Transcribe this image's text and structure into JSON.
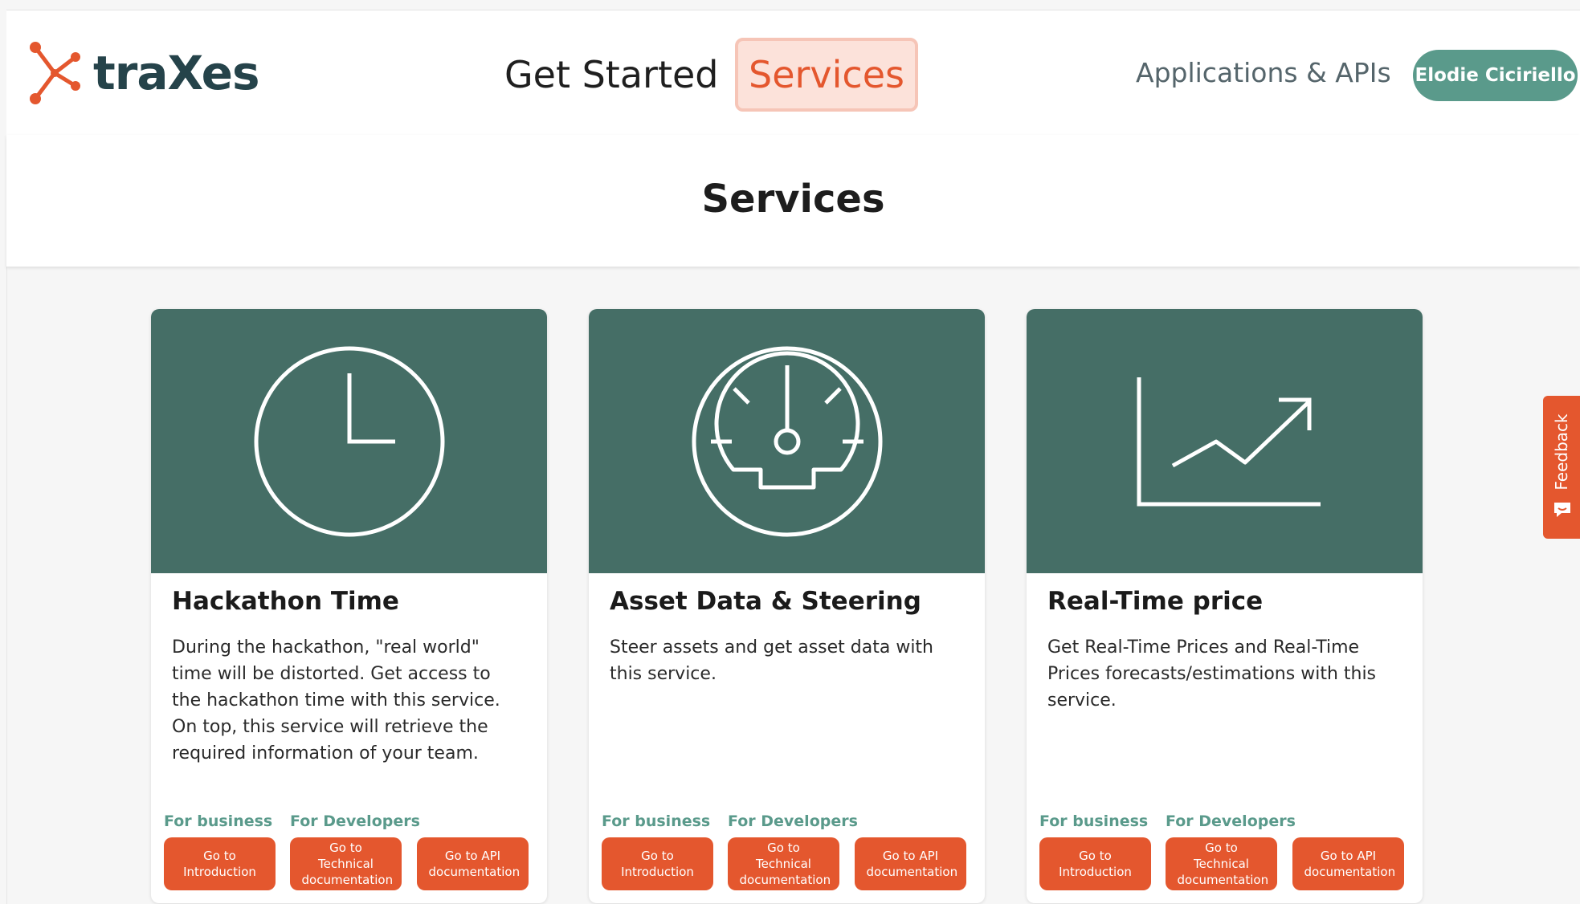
{
  "brand": {
    "name": "traXes",
    "accent": "#e4572e",
    "teal": "#456e66",
    "green": "#5a9a8b",
    "dark": "#25434a"
  },
  "nav": {
    "get_started": "Get Started",
    "services": "Services",
    "applications": "Applications & APIs",
    "user": "Elodie Ciciriello"
  },
  "page": {
    "title": "Services"
  },
  "cards": [
    {
      "icon": "clock-icon",
      "title": "Hackathon Time",
      "description": "During the hackathon, \"real world\" time will be distorted. Get access to the hackathon time with this service. On top, this service will retrieve the required information of your team.",
      "for_business": "For business",
      "for_developers": "For Developers",
      "btn_intro": "Go to Introduction",
      "btn_tech": "Go to Technical documentation",
      "btn_api": "Go to API documentation"
    },
    {
      "icon": "speedometer-icon",
      "title": "Asset Data & Steering",
      "description": "Steer assets and get asset data with this service.",
      "for_business": "For business",
      "for_developers": "For Developers",
      "btn_intro": "Go to Introduction",
      "btn_tech": "Go to Technical documentation",
      "btn_api": "Go to API documentation"
    },
    {
      "icon": "trending-chart-icon",
      "title": "Real-Time price",
      "description": "Get Real-Time Prices and Real-Time Prices forecasts/estimations with this service.",
      "for_business": "For business",
      "for_developers": "For Developers",
      "btn_intro": "Go to Introduction",
      "btn_tech": "Go to Technical documentation",
      "btn_api": "Go to API documentation"
    }
  ],
  "feedback": {
    "label": "Feedback",
    "icon": "chat-icon"
  }
}
